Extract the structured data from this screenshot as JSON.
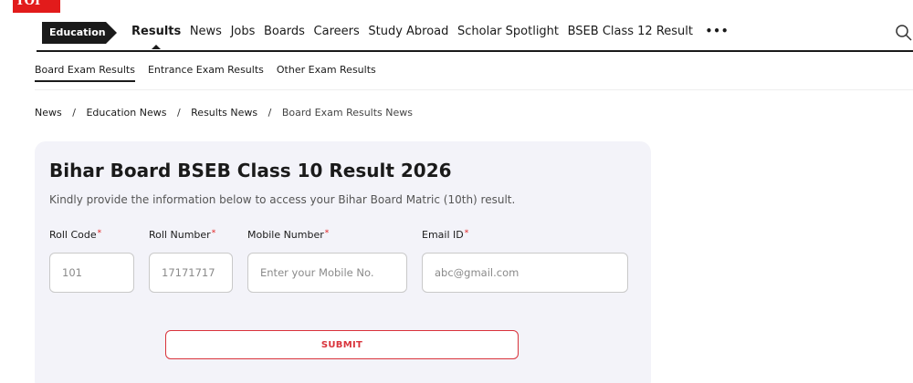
{
  "brand": {
    "logo_text": "TOI",
    "accent_color": "#e21b1b"
  },
  "topnav": {
    "section_tag": "Education",
    "items": [
      {
        "label": "Results",
        "active": true
      },
      {
        "label": "News"
      },
      {
        "label": "Jobs"
      },
      {
        "label": "Boards"
      },
      {
        "label": "Careers"
      },
      {
        "label": "Study Abroad"
      },
      {
        "label": "Scholar Spotlight"
      },
      {
        "label": "BSEB Class 12 Result"
      }
    ],
    "more_label": "•••",
    "search_icon": "search-icon"
  },
  "subnav": {
    "items": [
      {
        "label": "Board Exam Results",
        "active": true
      },
      {
        "label": "Entrance Exam Results"
      },
      {
        "label": "Other Exam Results"
      }
    ]
  },
  "breadcrumb": {
    "items": [
      "News",
      "Education News",
      "Results News"
    ],
    "current": "Board Exam Results News",
    "separator": "/"
  },
  "form": {
    "title": "Bihar Board BSEB Class 10 Result 2026",
    "subtitle": "Kindly provide the information below to access your Bihar Board Matric (10th) result.",
    "required_mark": "*",
    "fields": {
      "roll_code": {
        "label": "Roll Code",
        "placeholder": "101"
      },
      "roll_number": {
        "label": "Roll Number",
        "placeholder": "17171717"
      },
      "mobile": {
        "label": "Mobile Number",
        "placeholder": "Enter your Mobile No."
      },
      "email": {
        "label": "Email ID",
        "placeholder": "abc@gmail.com"
      }
    },
    "submit_label": "SUBMIT",
    "submit_color": "#d9333b"
  }
}
